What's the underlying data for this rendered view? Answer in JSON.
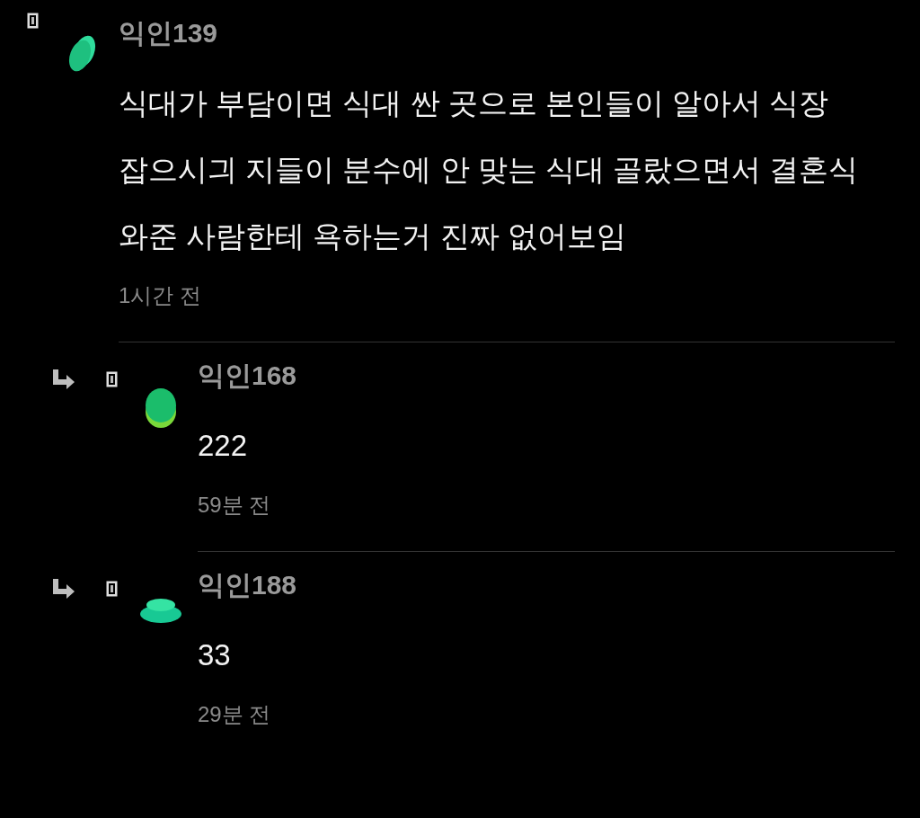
{
  "comments": [
    {
      "reply": false,
      "avatar": {
        "kind": "tilted"
      },
      "author": "익인139",
      "body": "식대가 부담이면 식대 싼 곳으로 본인들이 알아서 식장 잡으시긔 지들이 분수에 안 맞는 식대 골랐으면서 결혼식 와준 사람한테 욕하는거 진짜 없어보임",
      "time": "1시간 전"
    },
    {
      "reply": true,
      "avatar": {
        "kind": "stacked"
      },
      "author": "익인168",
      "body": "222",
      "time": "59분 전"
    },
    {
      "reply": true,
      "avatar": {
        "kind": "disc"
      },
      "author": "익인188",
      "body": "33",
      "time": "29분 전"
    }
  ]
}
